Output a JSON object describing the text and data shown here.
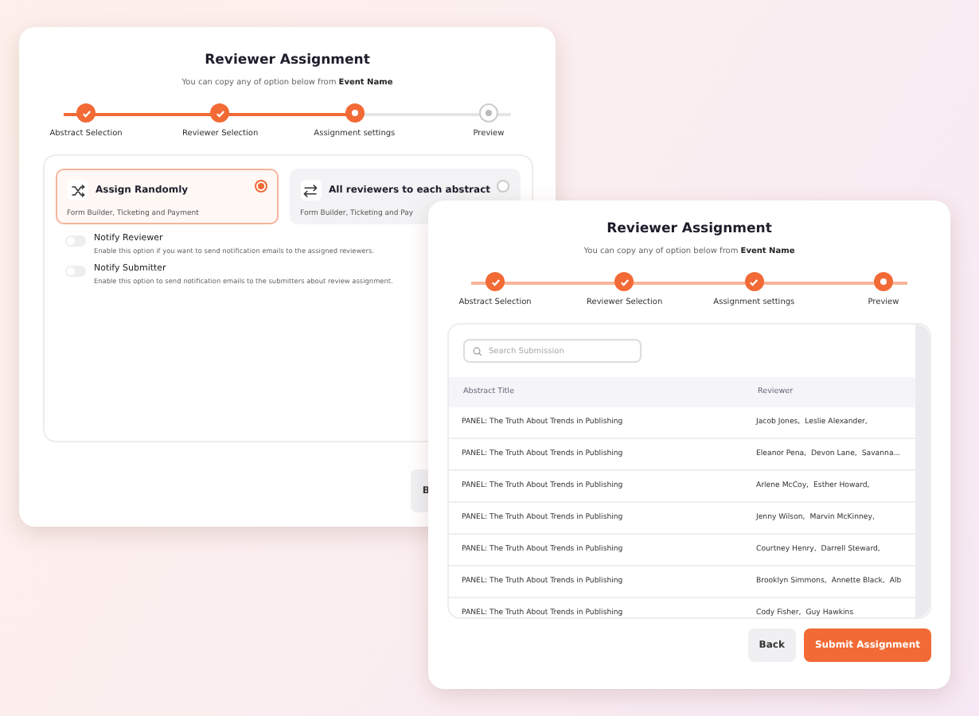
{
  "back_window": {
    "title": "Reviewer Assignment",
    "subtitle": "You can copy any of option below from **Event Name**",
    "steps": [
      {
        "label": "Abstract Selection",
        "completed": true
      },
      {
        "label": "Reviewer Selection",
        "completed": true
      },
      {
        "label": "Assignment settings",
        "completed": false
      },
      {
        "label": "Preview",
        "completed": false
      }
    ],
    "options": [
      {
        "kind": "shuffle",
        "title": "Assign Randomly",
        "description": "Form Builder, Ticketing and Payment",
        "selected": true
      },
      {
        "kind": "swap",
        "title": "All reviewers to each abstract",
        "description": "Form Builder, Ticketing and Pay",
        "selected": false
      }
    ],
    "toggles": [
      {
        "label": "Notify Reviewer",
        "description": "Enable this option if you want to send notification emails to the assigned reviewers.",
        "on": false
      },
      {
        "label": "Notify Submitter",
        "description": "Enable this option to send notification emails to the submitters about review assignment.",
        "on": false
      }
    ],
    "button": "B"
  },
  "front_window": {
    "title": "Reviewer Assignment",
    "subtitle": "You can copy any of option below from **Event Name**",
    "steps": [
      {
        "label": "Abstract Selection",
        "completed": true
      },
      {
        "label": "Reviewer Selection",
        "completed": true
      },
      {
        "label": "Assignment settings",
        "completed": true
      },
      {
        "label": "Preview",
        "completed": false
      }
    ],
    "search": {
      "placeholder": "Search Submission"
    },
    "table": {
      "columns": [
        "Abstract Title",
        "Reviewer"
      ],
      "rows": [
        [
          "PANEL: The Truth About Trends in Publishing",
          [
            "Jacob Jones,",
            "Leslie Alexander,"
          ]
        ],
        [
          "PANEL: The Truth About Trends in Publishing",
          [
            "Eleanor Pena,",
            "Devon Lane,",
            "Savanna..."
          ]
        ],
        [
          "PANEL: The Truth About Trends in Publishing",
          [
            "Arlene McCoy,",
            "Esther Howard,"
          ]
        ],
        [
          "PANEL: The Truth About Trends in Publishing",
          [
            "Jenny Wilson,",
            "Marvin McKinney,"
          ]
        ],
        [
          "PANEL: The Truth About Trends in Publishing",
          [
            "Courtney Henry,",
            "Darrell Steward,"
          ]
        ],
        [
          "PANEL: The Truth About Trends in Publishing",
          [
            "Brooklyn Simmons,",
            "Annette Black,",
            "Alb"
          ]
        ],
        [
          "PANEL: The Truth About Trends in Publishing",
          [
            "Cody Fisher,",
            "Guy Hawkins"
          ]
        ]
      ]
    },
    "buttons": [
      {
        "label": "Back",
        "kind": "secondary"
      },
      {
        "label": "Submit Assignment",
        "kind": "primary"
      }
    ]
  }
}
